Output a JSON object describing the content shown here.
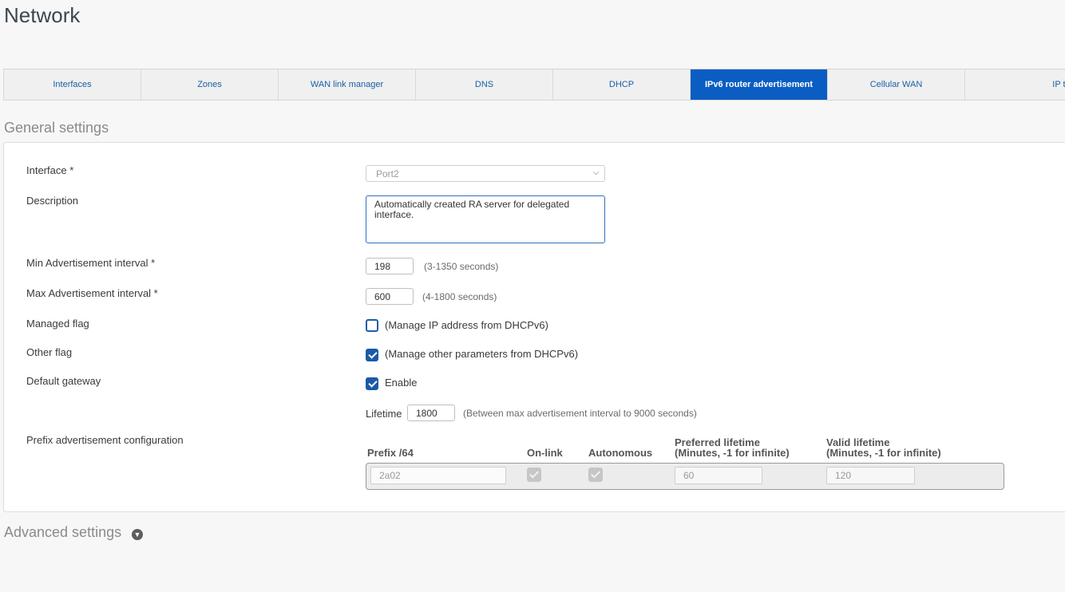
{
  "page": {
    "title": "Network"
  },
  "tabs": [
    {
      "label": "Interfaces",
      "active": false
    },
    {
      "label": "Zones",
      "active": false
    },
    {
      "label": "WAN link manager",
      "active": false
    },
    {
      "label": "DNS",
      "active": false
    },
    {
      "label": "DHCP",
      "active": false
    },
    {
      "label": "IPv6 router advertisement",
      "active": true
    },
    {
      "label": "Cellular WAN",
      "active": false
    },
    {
      "label": "IP tunnels",
      "active": false
    }
  ],
  "general": {
    "title": "General settings",
    "interface": {
      "label": "Interface *",
      "value": "Port2"
    },
    "description": {
      "label": "Description",
      "value": "Automatically created RA server for delegated interface."
    },
    "min_interval": {
      "label": "Min Advertisement interval *",
      "value": "198",
      "hint": "(3-1350 seconds)"
    },
    "max_interval": {
      "label": "Max Advertisement interval *",
      "value": "600",
      "hint": "(4-1800 seconds)"
    },
    "managed_flag": {
      "label": "Managed flag",
      "checked": false,
      "text": "(Manage IP address from DHCPv6)"
    },
    "other_flag": {
      "label": "Other flag",
      "checked": true,
      "text": "(Manage other parameters from DHCPv6)"
    },
    "default_gateway": {
      "label": "Default gateway",
      "checked": true,
      "text": "Enable"
    },
    "lifetime": {
      "label": "Lifetime",
      "value": "1800",
      "hint": "(Between max advertisement interval to 9000 seconds)"
    },
    "prefix": {
      "label": "Prefix advertisement configuration",
      "headers": {
        "prefix": "Prefix /64",
        "onlink": "On-link",
        "autonomous": "Autonomous",
        "preferred_1": "Preferred lifetime",
        "preferred_2": "(Minutes, -1 for infinite)",
        "valid_1": "Valid lifetime",
        "valid_2": "(Minutes, -1 for infinite)"
      },
      "row": {
        "prefix": "2a02",
        "onlink": true,
        "autonomous": true,
        "preferred": "60",
        "valid": "120"
      }
    }
  },
  "advanced": {
    "title": "Advanced settings",
    "icon": "chevron-down-circle-icon"
  }
}
